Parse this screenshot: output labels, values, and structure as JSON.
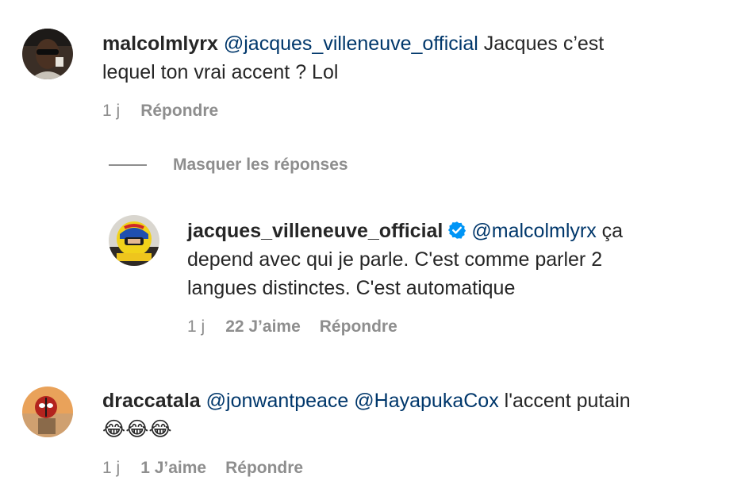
{
  "comments": [
    {
      "username": "malcolmlyrx",
      "mention": "@jacques_villeneuve_official",
      "text_line1": "Jacques c’est",
      "text_line2": "lequel ton vrai accent ? Lol",
      "time": "1 j",
      "reply_label": "Répondre"
    },
    {
      "username": "draccatala",
      "mention1": "@jonwantpeace",
      "mention2": "@HayapukaCox",
      "text": "l'accent putain",
      "emoji": "😂😂😂",
      "time": "1 j",
      "likes": "1 J’aime",
      "reply_label": "Répondre"
    }
  ],
  "hide_replies_label": "Masquer les réponses",
  "reply": {
    "username": "jacques_villeneuve_official",
    "verified": true,
    "mention": "@malcolmlyrx",
    "text_line1": "ça",
    "text_line2": "depend avec qui je parle. C'est comme parler 2",
    "text_line3": "langues distinctes. C'est automatique",
    "time": "1 j",
    "likes": "22 J’aime",
    "reply_label": "Répondre"
  },
  "colors": {
    "text": "#262626",
    "mention": "#00376b",
    "secondary": "#8e8e8e",
    "verified": "#0095f6"
  },
  "icons": {
    "verified": "verified-badge-icon",
    "emoji": "face-with-tears-of-joy-icon"
  }
}
